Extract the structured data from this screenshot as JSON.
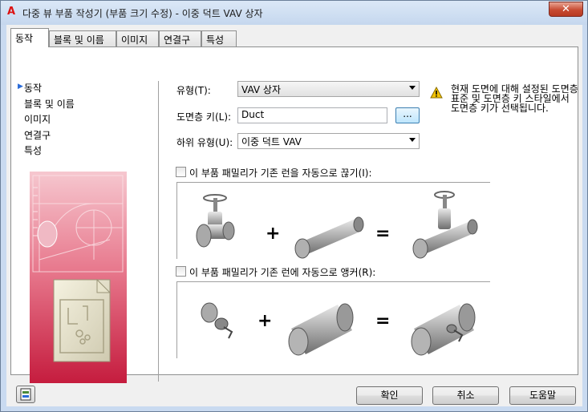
{
  "window": {
    "title": "다중 뷰 부품 작성기 (부품 크기 수정) - 이중 덕트 VAV 상자",
    "app_icon": "A",
    "close_glyph": "✕"
  },
  "tabs": [
    {
      "label": "동작",
      "active": true
    },
    {
      "label": "블록 및 이름",
      "active": false
    },
    {
      "label": "이미지",
      "active": false
    },
    {
      "label": "연결구",
      "active": false
    },
    {
      "label": "특성",
      "active": false
    }
  ],
  "nav": {
    "items": [
      {
        "label": "동작",
        "selected": true
      },
      {
        "label": "블록 및 이름",
        "selected": false
      },
      {
        "label": "이미지",
        "selected": false
      },
      {
        "label": "연결구",
        "selected": false
      },
      {
        "label": "특성",
        "selected": false
      }
    ]
  },
  "form": {
    "type_label": "유형(T):",
    "type_value": "VAV 상자",
    "layer_key_label": "도면층 키(L):",
    "layer_key_value": "Duct",
    "browse_label": "...",
    "subtype_label": "하위 유형(U):",
    "subtype_value": "이중 덕트 VAV",
    "warning_text": "현재 도면에 대해 설정된 도면층 표준 및 도면층 키 스타일에서 도면층 키가 선택됩니다.",
    "break_checkbox_label": "이 부품 패밀리가 기존 런을 자동으로 끊기(I):",
    "break_checked": false,
    "anchor_checkbox_label": "이 부품 패밀리가 기존 런에 자동으로 앵커(R):",
    "anchor_checked": false,
    "plus_glyph": "+",
    "equals_glyph": "="
  },
  "buttons": {
    "ok": "확인",
    "cancel": "취소",
    "help": "도움말"
  },
  "colors": {
    "accent_blue": "#2a6bd8",
    "warning_yellow": "#f2c200",
    "art_red": "#d4314e"
  }
}
